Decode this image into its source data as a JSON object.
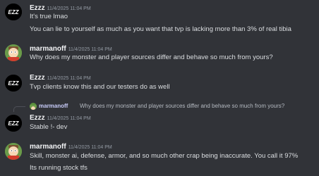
{
  "messages": [
    {
      "author": "Ezzz",
      "timestamp": "11/4/2025 11:04 PM",
      "avatar": "ezzz-logo-avatar",
      "lines": [
        "It's true lmao",
        "You can lie to yourself as much as you want that tvp is lacking more than 3% of real tibia"
      ]
    },
    {
      "author": "marmanoff",
      "timestamp": "11/4/2025 11:04 PM",
      "avatar": "south-park-character-avatar",
      "lines": [
        "Why does my monster and player sources differ and behave so much from yours?"
      ]
    },
    {
      "author": "Ezzz",
      "timestamp": "11/4/2025 11:04 PM",
      "avatar": "ezzz-logo-avatar",
      "lines": [
        "Tvp clients know this and our testers do as well"
      ]
    },
    {
      "author": "Ezzz",
      "timestamp": "11/4/2025 11:04 PM",
      "avatar": "ezzz-logo-avatar",
      "reply_to": {
        "author": "marmanoff",
        "text": "Why does my monster and player sources differ and behave so much from yours?"
      },
      "lines": [
        "Stable !- dev"
      ]
    },
    {
      "author": "marmanoff",
      "timestamp": "11/4/2025 11:04 PM",
      "avatar": "south-park-character-avatar",
      "lines": [
        "Skill, monster ai, defense, armor, and so much other crap being inaccurate. You call it 97%",
        "Its running stock tfs"
      ]
    }
  ],
  "colors": {
    "background": "#313338",
    "username": "#f2f3f5",
    "timestamp": "#949ba4",
    "text": "#dbdee1",
    "reply_name": "#c9cdfb"
  }
}
